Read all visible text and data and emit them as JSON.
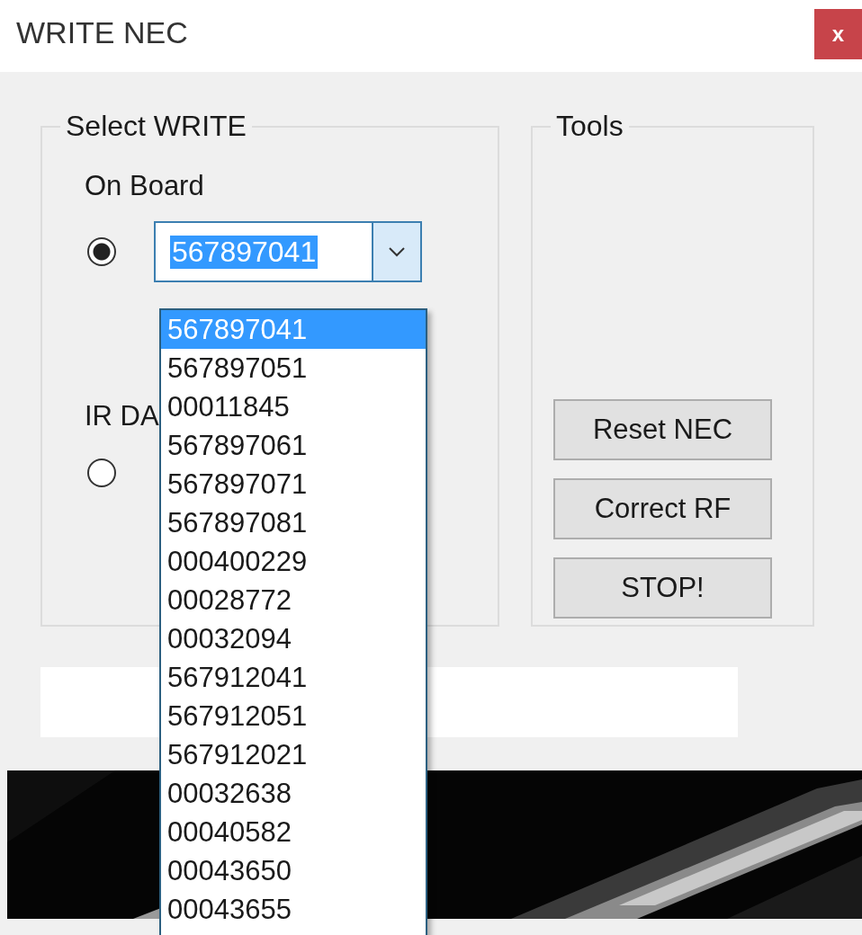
{
  "window": {
    "title": "WRITE NEC",
    "close": "x"
  },
  "select_write": {
    "title": "Select WRITE",
    "options": [
      {
        "label": "On Board",
        "selected": true
      },
      {
        "label": "IR DA",
        "selected": false
      }
    ],
    "combo": {
      "value": "567897041",
      "expanded": true,
      "items": [
        {
          "label": "567897041",
          "selected": true
        },
        {
          "label": "567897051",
          "selected": false
        },
        {
          "label": "00011845",
          "selected": false
        },
        {
          "label": "567897061",
          "selected": false
        },
        {
          "label": "567897071",
          "selected": false
        },
        {
          "label": "567897081",
          "selected": false
        },
        {
          "label": "000400229",
          "selected": false
        },
        {
          "label": "00028772",
          "selected": false
        },
        {
          "label": "00032094",
          "selected": false
        },
        {
          "label": "567912041",
          "selected": false
        },
        {
          "label": "567912051",
          "selected": false
        },
        {
          "label": "567912021",
          "selected": false
        },
        {
          "label": "00032638",
          "selected": false
        },
        {
          "label": "00040582",
          "selected": false
        },
        {
          "label": "00043650",
          "selected": false
        },
        {
          "label": "00043655",
          "selected": false
        }
      ]
    }
  },
  "tools": {
    "title": "Tools",
    "buttons": [
      "Reset NEC",
      "Correct RF",
      "STOP!"
    ]
  }
}
